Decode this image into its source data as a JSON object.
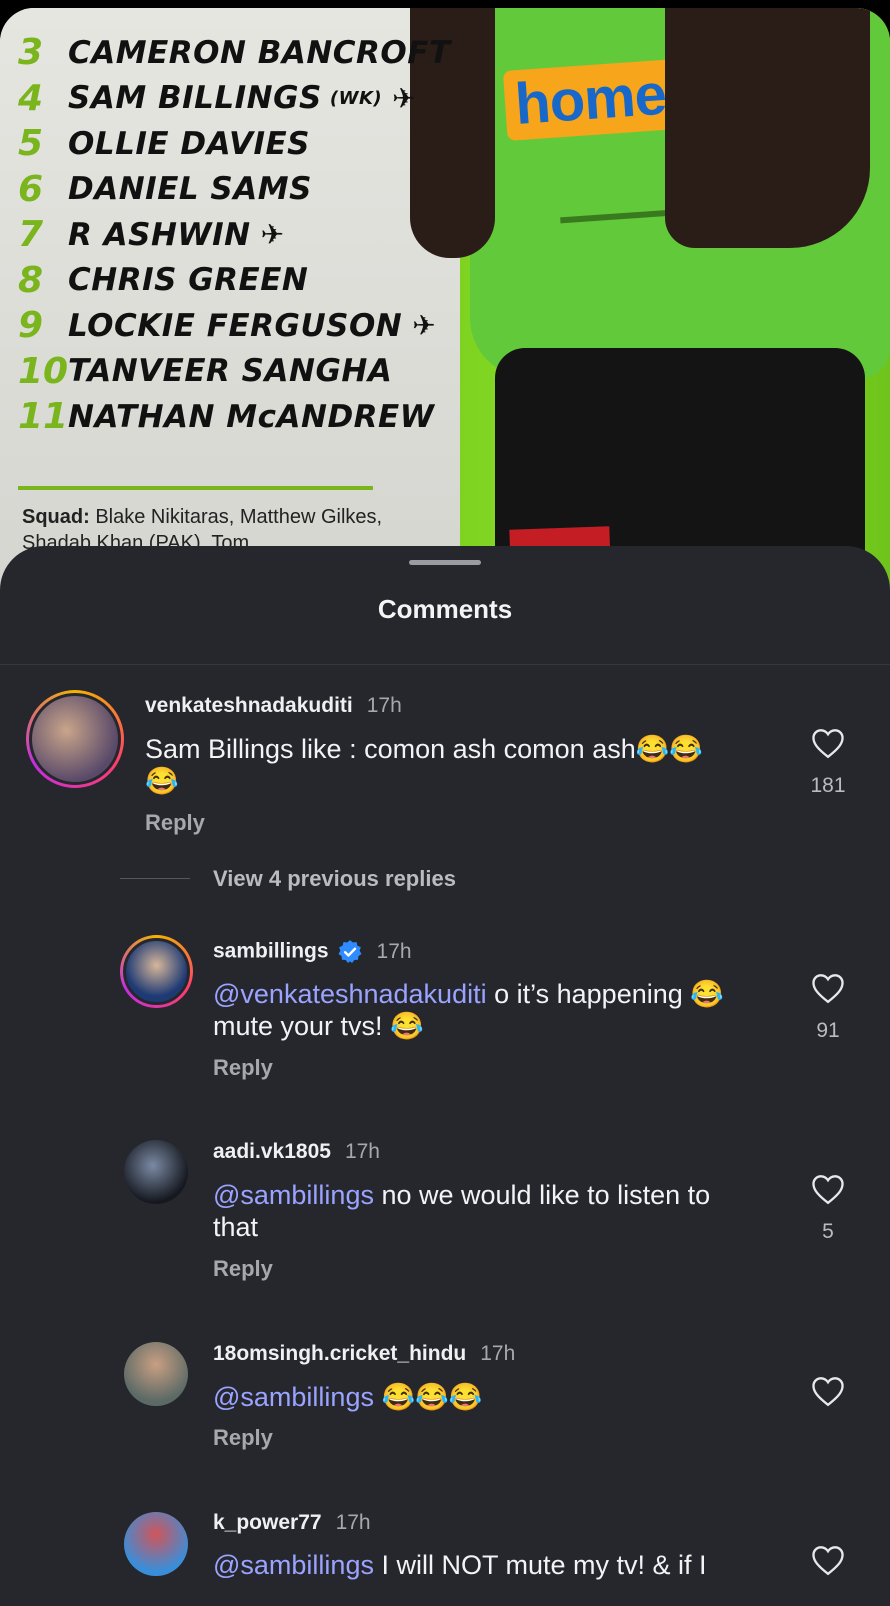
{
  "poster": {
    "lineup": [
      {
        "num": "3",
        "name": "CAMERON BANCROFT",
        "plane": false
      },
      {
        "num": "4",
        "name": "SAM BILLINGS",
        "tag": "(WK)",
        "plane": true
      },
      {
        "num": "5",
        "name": "OLLIE DAVIES",
        "plane": false
      },
      {
        "num": "6",
        "name": "DANIEL SAMS",
        "plane": false
      },
      {
        "num": "7",
        "name": "R ASHWIN",
        "plane": true
      },
      {
        "num": "8",
        "name": "CHRIS GREEN",
        "plane": false
      },
      {
        "num": "9",
        "name": "LOCKIE FERGUSON",
        "plane": true
      },
      {
        "num": "10",
        "name": "TANVEER SANGHA",
        "plane": false
      },
      {
        "num": "11",
        "name": "NATHAN McANDREW",
        "plane": false
      }
    ],
    "squad_label": "Squad:",
    "squad_text": "Blake Nikitaras, Matthew Gilkes, Shadab Khan (PAK), Tom",
    "sponsor": "homesta"
  },
  "sheet": {
    "title": "Comments",
    "view_previous": "View 4 previous replies",
    "reply_label": "Reply"
  },
  "comments": [
    {
      "username": "venkateshnadakuditi",
      "time": "17h",
      "text_line1": "Sam Billings like : comon ash comon ash😂😂",
      "text_line2": "😂",
      "likes": "181"
    },
    {
      "username": "sambillings",
      "time": "17h",
      "mention": "@venkateshnadakuditi",
      "text_line1": " o it’s happening 😂",
      "text_line2": "mute your tvs! 😂",
      "likes": "91"
    },
    {
      "username": "aadi.vk1805",
      "time": "17h",
      "mention": "@sambillings",
      "text_line1": " no we would like to listen to",
      "text_line2": "that",
      "likes": "5"
    },
    {
      "username": "18omsingh.cricket_hindu",
      "time": "17h",
      "mention": "@sambillings",
      "text_line1": " 😂😂😂",
      "likes": ""
    },
    {
      "username": "k_power77",
      "time": "17h",
      "mention": "@sambillings",
      "text_line1": " I will NOT mute my tv! & if I",
      "likes": ""
    }
  ],
  "colors": {
    "sheet_bg": "#25272d",
    "mention": "#9aa3ff",
    "accent_green": "#7ab51d",
    "verified_blue": "#2f8cff"
  }
}
